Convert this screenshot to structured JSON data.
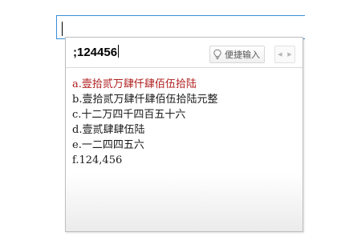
{
  "input": {
    "value": ""
  },
  "ime": {
    "composition": ";124456",
    "quick_input_label": "便捷输入",
    "icons": {
      "quick_input": "lightbulb-icon",
      "prev": "left-arrow-icon",
      "next": "right-arrow-icon"
    },
    "candidates": [
      {
        "label": "a.壹拾贰万肆仟肆佰伍拾陆"
      },
      {
        "label": "b.壹拾贰万肆仟肆佰伍拾陆元整"
      },
      {
        "label": "c.十二万四千四百五十六"
      },
      {
        "label": "d.壹贰肆肆伍陆"
      },
      {
        "label": "e.一二四四五六"
      },
      {
        "label": "f.124,456"
      }
    ],
    "highlight_color": "#b01e1e"
  }
}
